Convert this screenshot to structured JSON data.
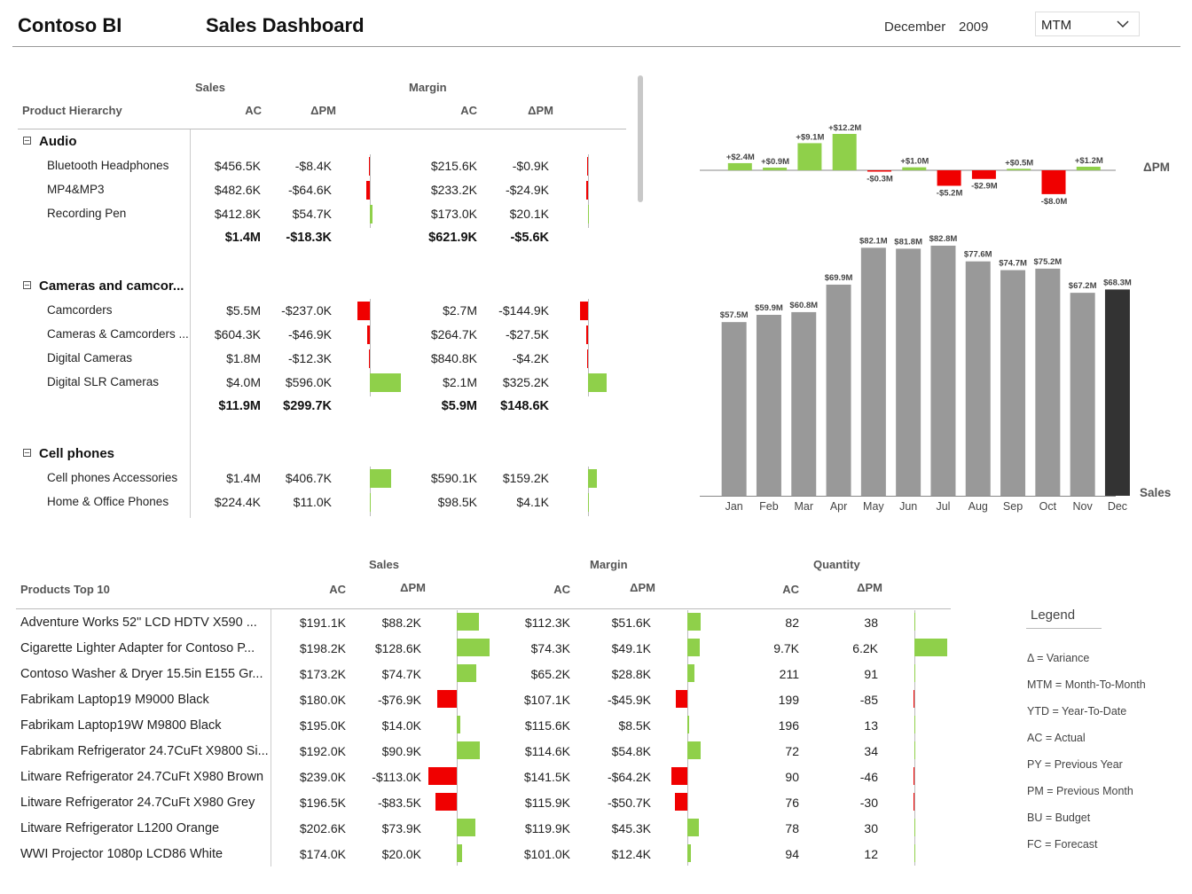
{
  "header": {
    "brand": "Contoso BI",
    "title": "Sales Dashboard",
    "month": "December",
    "year": "2009",
    "mode": "MTM"
  },
  "hierarchy": {
    "group_sales": "Sales",
    "group_margin": "Margin",
    "col_product": "Product Hierarchy",
    "col_ac": "AC",
    "col_dpm": "ΔPM",
    "groups": [
      {
        "name": "Audio",
        "rows": [
          {
            "name": "Bluetooth Headphones",
            "s_ac": "$456.5K",
            "s_dpm": "-$8.4K",
            "s_v": -8.4,
            "m_ac": "$215.6K",
            "m_dpm": "-$0.9K",
            "m_v": -0.9
          },
          {
            "name": "MP4&MP3",
            "s_ac": "$482.6K",
            "s_dpm": "-$64.6K",
            "s_v": -64.6,
            "m_ac": "$233.2K",
            "m_dpm": "-$24.9K",
            "m_v": -24.9
          },
          {
            "name": "Recording Pen",
            "s_ac": "$412.8K",
            "s_dpm": "$54.7K",
            "s_v": 54.7,
            "m_ac": "$173.0K",
            "m_dpm": "$20.1K",
            "m_v": 20.1
          }
        ],
        "total": {
          "s_ac": "$1.4M",
          "s_dpm": "-$18.3K",
          "m_ac": "$621.9K",
          "m_dpm": "-$5.6K"
        }
      },
      {
        "name": "Cameras and camcor...",
        "rows": [
          {
            "name": "Camcorders",
            "s_ac": "$5.5M",
            "s_dpm": "-$237.0K",
            "s_v": -237.0,
            "m_ac": "$2.7M",
            "m_dpm": "-$144.9K",
            "m_v": -144.9
          },
          {
            "name": "Cameras & Camcorders ...",
            "s_ac": "$604.3K",
            "s_dpm": "-$46.9K",
            "s_v": -46.9,
            "m_ac": "$264.7K",
            "m_dpm": "-$27.5K",
            "m_v": -27.5
          },
          {
            "name": "Digital Cameras",
            "s_ac": "$1.8M",
            "s_dpm": "-$12.3K",
            "s_v": -12.3,
            "m_ac": "$840.8K",
            "m_dpm": "-$4.2K",
            "m_v": -4.2
          },
          {
            "name": "Digital SLR Cameras",
            "s_ac": "$4.0M",
            "s_dpm": "$596.0K",
            "s_v": 596.0,
            "m_ac": "$2.1M",
            "m_dpm": "$325.2K",
            "m_v": 325.2
          }
        ],
        "total": {
          "s_ac": "$11.9M",
          "s_dpm": "$299.7K",
          "m_ac": "$5.9M",
          "m_dpm": "$148.6K"
        }
      },
      {
        "name": "Cell phones",
        "rows": [
          {
            "name": "Cell phones Accessories",
            "s_ac": "$1.4M",
            "s_dpm": "$406.7K",
            "s_v": 406.7,
            "m_ac": "$590.1K",
            "m_dpm": "$159.2K",
            "m_v": 159.2
          },
          {
            "name": "Home & Office Phones",
            "s_ac": "$224.4K",
            "s_dpm": "$11.0K",
            "s_v": 11.0,
            "m_ac": "$98.5K",
            "m_dpm": "$4.1K",
            "m_v": 4.1
          }
        ],
        "total": null
      }
    ]
  },
  "chart_data": [
    {
      "type": "bar",
      "categories": [
        "Jan",
        "Feb",
        "Mar",
        "Apr",
        "May",
        "Jun",
        "Jul",
        "Aug",
        "Sep",
        "Oct",
        "Nov",
        "Dec"
      ],
      "values": [
        2.4,
        0.9,
        9.1,
        12.2,
        -0.3,
        1.0,
        -5.2,
        -2.9,
        0.5,
        -8.0,
        1.2
      ],
      "data_labels": [
        "+$2.4M",
        "+$0.9M",
        "+$9.1M",
        "+$12.2M",
        "-$0.3M",
        "+$1.0M",
        "-$5.2M",
        "-$2.9M",
        "+$0.5M",
        "-$8.0M",
        "+$1.2M"
      ],
      "ylabel": "ΔPM",
      "colors": {
        "positive": "#8fd04a",
        "negative": "#f00000"
      }
    },
    {
      "type": "bar",
      "categories": [
        "Jan",
        "Feb",
        "Mar",
        "Apr",
        "May",
        "Jun",
        "Jul",
        "Aug",
        "Sep",
        "Oct",
        "Nov",
        "Dec"
      ],
      "values": [
        57.5,
        59.9,
        60.8,
        69.9,
        82.1,
        81.8,
        82.8,
        77.6,
        74.7,
        75.2,
        67.2,
        68.3
      ],
      "data_labels": [
        "$57.5M",
        "$59.9M",
        "$60.8M",
        "$69.9M",
        "$82.1M",
        "$81.8M",
        "$82.8M",
        "$77.6M",
        "$74.7M",
        "$75.2M",
        "$67.2M",
        "$68.3M"
      ],
      "ylabel": "Sales",
      "colors": {
        "bar": "#999999",
        "highlight": "#333333"
      }
    }
  ],
  "top10": {
    "col_product": "Products Top 10",
    "group_sales": "Sales",
    "group_margin": "Margin",
    "group_qty": "Quantity",
    "col_ac": "AC",
    "col_dpm": "ΔPM",
    "rows": [
      {
        "name": "Adventure Works 52\" LCD HDTV X590 ...",
        "s_ac": "$191.1K",
        "s_dpm": "$88.2K",
        "s_v": 88.2,
        "m_ac": "$112.3K",
        "m_dpm": "$51.6K",
        "m_v": 51.6,
        "q_ac": "82",
        "q_dpm": "38",
        "q_v": 38
      },
      {
        "name": "Cigarette Lighter Adapter for Contoso P...",
        "s_ac": "$198.2K",
        "s_dpm": "$128.6K",
        "s_v": 128.6,
        "m_ac": "$74.3K",
        "m_dpm": "$49.1K",
        "m_v": 49.1,
        "q_ac": "9.7K",
        "q_dpm": "6.2K",
        "q_v": 6200
      },
      {
        "name": "Contoso Washer & Dryer 15.5in E155 Gr...",
        "s_ac": "$173.2K",
        "s_dpm": "$74.7K",
        "s_v": 74.7,
        "m_ac": "$65.2K",
        "m_dpm": "$28.8K",
        "m_v": 28.8,
        "q_ac": "211",
        "q_dpm": "91",
        "q_v": 91
      },
      {
        "name": "Fabrikam Laptop19 M9000 Black",
        "s_ac": "$180.0K",
        "s_dpm": "-$76.9K",
        "s_v": -76.9,
        "m_ac": "$107.1K",
        "m_dpm": "-$45.9K",
        "m_v": -45.9,
        "q_ac": "199",
        "q_dpm": "-85",
        "q_v": -85
      },
      {
        "name": "Fabrikam Laptop19W M9800 Black",
        "s_ac": "$195.0K",
        "s_dpm": "$14.0K",
        "s_v": 14.0,
        "m_ac": "$115.6K",
        "m_dpm": "$8.5K",
        "m_v": 8.5,
        "q_ac": "196",
        "q_dpm": "13",
        "q_v": 13
      },
      {
        "name": "Fabrikam Refrigerator 24.7CuFt X9800 Si...",
        "s_ac": "$192.0K",
        "s_dpm": "$90.9K",
        "s_v": 90.9,
        "m_ac": "$114.6K",
        "m_dpm": "$54.8K",
        "m_v": 54.8,
        "q_ac": "72",
        "q_dpm": "34",
        "q_v": 34
      },
      {
        "name": "Litware Refrigerator 24.7CuFt X980 Brown",
        "s_ac": "$239.0K",
        "s_dpm": "-$113.0K",
        "s_v": -113.0,
        "m_ac": "$141.5K",
        "m_dpm": "-$64.2K",
        "m_v": -64.2,
        "q_ac": "90",
        "q_dpm": "-46",
        "q_v": -46
      },
      {
        "name": "Litware Refrigerator 24.7CuFt X980 Grey",
        "s_ac": "$196.5K",
        "s_dpm": "-$83.5K",
        "s_v": -83.5,
        "m_ac": "$115.9K",
        "m_dpm": "-$50.7K",
        "m_v": -50.7,
        "q_ac": "76",
        "q_dpm": "-30",
        "q_v": -30
      },
      {
        "name": "Litware Refrigerator L1200 Orange",
        "s_ac": "$202.6K",
        "s_dpm": "$73.9K",
        "s_v": 73.9,
        "m_ac": "$119.9K",
        "m_dpm": "$45.3K",
        "m_v": 45.3,
        "q_ac": "78",
        "q_dpm": "30",
        "q_v": 30
      },
      {
        "name": "WWI Projector 1080p LCD86 White",
        "s_ac": "$174.0K",
        "s_dpm": "$20.0K",
        "s_v": 20.0,
        "m_ac": "$101.0K",
        "m_dpm": "$12.4K",
        "m_v": 12.4,
        "q_ac": "94",
        "q_dpm": "12",
        "q_v": 12
      }
    ]
  },
  "legend": {
    "title": "Legend",
    "items": [
      "Δ = Variance",
      "MTM = Month-To-Month",
      "YTD = Year-To-Date",
      "AC = Actual",
      "PY = Previous Year",
      "PM = Previous Month",
      "BU = Budget",
      "FC = Forecast"
    ]
  }
}
